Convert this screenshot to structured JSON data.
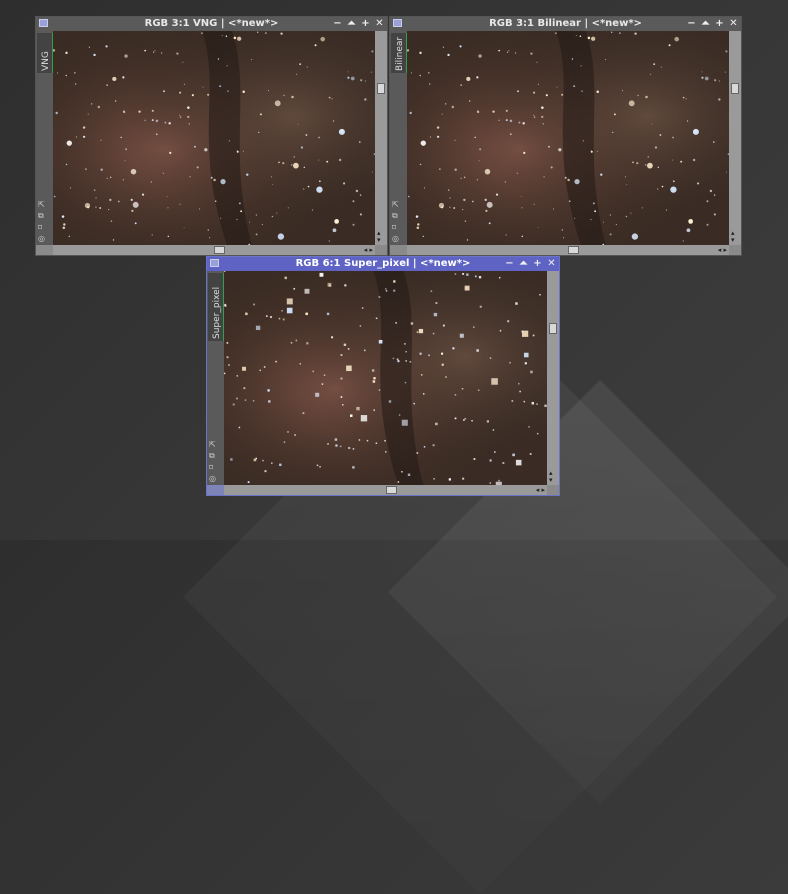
{
  "windows": [
    {
      "id": "vng",
      "title": "RGB 3:1 VNG | <*new*>",
      "tab": "VNG",
      "active": false
    },
    {
      "id": "bilinear",
      "title": "RGB 3:1 Bilinear | <*new*>",
      "tab": "Bilinear",
      "active": false
    },
    {
      "id": "superpixel",
      "title": "RGB 6:1 Super_pixel | <*new*>",
      "tab": "Super_pixel",
      "active": true
    }
  ],
  "controls": {
    "minimize": "−",
    "shade": "⏶",
    "maximize": "+",
    "close": "✕"
  },
  "icons": {
    "scroll_up": "▴",
    "scroll_down": "▾",
    "scroll_left": "◂",
    "scroll_right": "▸",
    "sidebar": [
      "⇱",
      "⧉",
      "⌑",
      "◎"
    ]
  },
  "colors": {
    "titlebar_inactive": "#5a5a5a",
    "titlebar_active": "#5f63c4",
    "tab_accent": "#2fa24a"
  }
}
